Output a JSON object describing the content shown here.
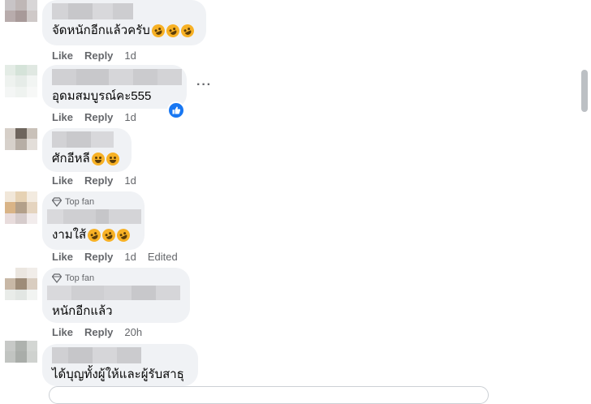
{
  "comments": [
    {
      "text": "จัดหนักอีกแล้วครับ",
      "emoji_count": 3,
      "emoji": "rofl",
      "like": "Like",
      "reply": "Reply",
      "time": "1d",
      "edited": "",
      "top_fan": ""
    },
    {
      "text": "อุดมสมบูรณ์คะ555",
      "emoji_count": 0,
      "emoji": "",
      "like": "Like",
      "reply": "Reply",
      "time": "1d",
      "edited": "",
      "top_fan": "",
      "reaction_icon": "thumbs-up-icon",
      "more": "···"
    },
    {
      "text": "ศักอีหลี",
      "emoji_count": 2,
      "emoji": "grin",
      "like": "Like",
      "reply": "Reply",
      "time": "1d",
      "edited": "",
      "top_fan": ""
    },
    {
      "text": "งามใส้",
      "emoji_count": 3,
      "emoji": "rofl",
      "like": "Like",
      "reply": "Reply",
      "time": "1d",
      "edited": "Edited",
      "top_fan": "Top fan"
    },
    {
      "text": "หนักอีกแล้ว",
      "emoji_count": 0,
      "emoji": "",
      "like": "Like",
      "reply": "Reply",
      "time": "20h",
      "edited": "",
      "top_fan": "Top fan"
    },
    {
      "text": "ได้บุญทั้งผู้ให้และผู้รับสาธุ",
      "emoji_count": 0,
      "emoji": "",
      "like": "",
      "reply": "",
      "time": "",
      "edited": "",
      "top_fan": ""
    }
  ],
  "colors": {
    "bubble": "#f0f2f5",
    "meta": "#65676b",
    "accent": "#1877f2"
  }
}
